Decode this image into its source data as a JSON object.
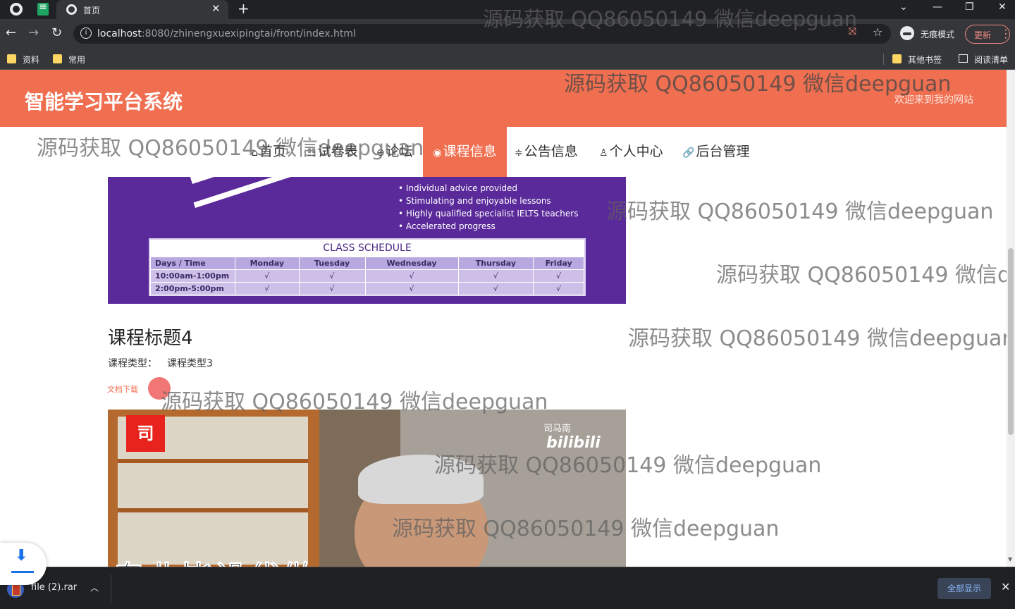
{
  "browser": {
    "tab_title": "首页",
    "url_host": "localhost",
    "url_rest": ":8080/zhinengxuexipingtai/front/index.html",
    "incognito_label": "无痕模式",
    "update_label": "更新",
    "bookmarks": [
      "资料",
      "常用"
    ],
    "bookmarks_right": [
      "其他书签",
      "阅读清单"
    ]
  },
  "site": {
    "title": "智能学习平台系统",
    "welcome": "欢迎来到我的网站"
  },
  "nav": {
    "items": [
      {
        "icon": "home-icon",
        "label": "首页"
      },
      {
        "icon": "list-icon",
        "label": "试卷表"
      },
      {
        "icon": "chat-icon",
        "label": "论坛"
      },
      {
        "icon": "globe-icon",
        "label": "课程信息"
      },
      {
        "icon": "sliders-icon",
        "label": "公告信息"
      },
      {
        "icon": "user-icon",
        "label": "个人中心"
      },
      {
        "icon": "link-icon",
        "label": "后台管理"
      }
    ],
    "active_index": 3
  },
  "course_image": {
    "bullets": [
      "• Individual advice provided",
      "• Stimulating and enjoyable lessons",
      "• Highly qualified specialist IELTS teachers",
      "• Accelerated progress"
    ],
    "schedule_title": "CLASS SCHEDULE",
    "schedule_header": [
      "Days / Time",
      "Monday",
      "Tuesday",
      "Wednesday",
      "Thursday",
      "Friday"
    ],
    "schedule_rows": [
      [
        "10:00am-1:00pm",
        "√",
        "√",
        "√",
        "√",
        "√"
      ],
      [
        "2:00pm-5:00pm",
        "√",
        "√",
        "√",
        "√",
        "√"
      ]
    ]
  },
  "course": {
    "title": "课程标题4",
    "type_label": "课程类型：",
    "type_value": "课程类型3",
    "doc_link": "文档下载"
  },
  "video": {
    "logo_char": "司",
    "brand_name": "司马南",
    "brand_site": "bilibili"
  },
  "overlay_banner": "专业毕设代做",
  "watermark_text": "源码获取 QQ86050149 微信deepguan",
  "downloads": {
    "file_name": "file (2).rar",
    "show_all": "全部显示"
  }
}
